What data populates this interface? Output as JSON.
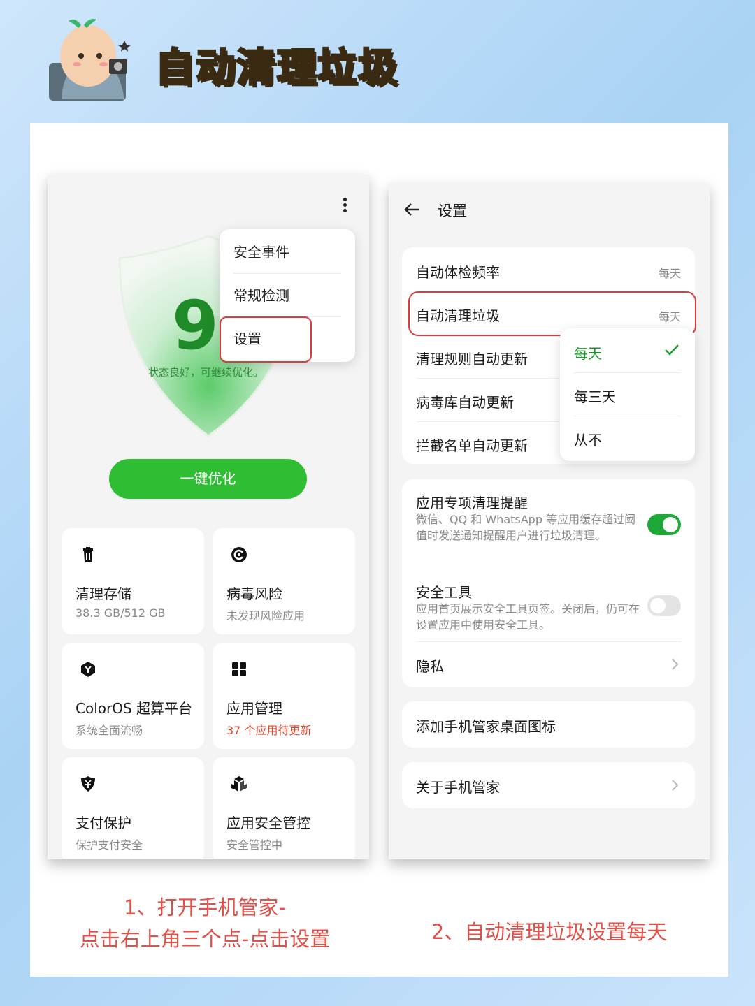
{
  "header": {
    "title": "自动清理垃圾"
  },
  "left_phone": {
    "score": "95",
    "status": "状态良好，可继续优化。",
    "menu": [
      "安全事件",
      "常规检测",
      "设置"
    ],
    "optimize_button": "一键优化",
    "tiles": [
      {
        "title": "清理存储",
        "subtitle": "38.3 GB/512 GB",
        "icon": "trash-icon"
      },
      {
        "title": "病毒风险",
        "subtitle": "未发现风险应用",
        "icon": "virus-scan-icon"
      },
      {
        "title": "ColorOS 超算平台",
        "subtitle": "系统全面流畅",
        "icon": "coloros-icon"
      },
      {
        "title": "应用管理",
        "subtitle": "37 个应用待更新",
        "icon": "app-grid-icon"
      },
      {
        "title": "支付保护",
        "subtitle": "保护支付安全",
        "icon": "payment-shield-icon"
      },
      {
        "title": "应用安全管控",
        "subtitle": "安全管控中",
        "icon": "cubes-icon"
      }
    ]
  },
  "right_phone": {
    "title": "设置",
    "group1": [
      {
        "label": "自动体检频率",
        "value": "每天"
      },
      {
        "label": "自动清理垃圾",
        "value": "每天"
      },
      {
        "label": "清理规则自动更新",
        "value": ""
      },
      {
        "label": "病毒库自动更新",
        "value": ""
      },
      {
        "label": "拦截名单自动更新",
        "value": ""
      }
    ],
    "dropdown": [
      "每天",
      "每三天",
      "从不"
    ],
    "group2": {
      "item1_label": "应用专项清理提醒",
      "item1_desc": "微信、QQ 和 WhatsApp 等应用缓存超过阈值时发送通知提醒用户进行垃圾清理。",
      "item1_on": true,
      "item2_label": "安全工具",
      "item2_desc": "应用首页展示安全工具页签。关闭后，仍可在设置应用中使用安全工具。",
      "item2_on": false,
      "item3_label": "隐私"
    },
    "shortcut": "添加手机管家桌面图标",
    "about": "关于手机管家"
  },
  "captions": {
    "left_line1": "1、打开手机管家-",
    "left_line2": "点击右上角三个点-点击设置",
    "right": "2、自动清理垃圾设置每天"
  },
  "colors": {
    "accent": "#2ebd33",
    "highlight": "#e03a3a",
    "caption": "#e25048"
  }
}
